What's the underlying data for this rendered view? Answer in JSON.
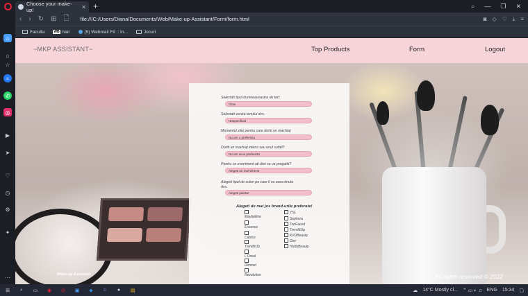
{
  "browser": {
    "tab_title": "Choose your make-up!",
    "url": "file:///C:/Users/Diana/Documents/Web/Make-up-Assistant/Form/form.html",
    "bookmarks": [
      "Faculta",
      "hair",
      "(5) Webmail FII :: In...",
      "Jocuri"
    ],
    "wb_badge": "WB"
  },
  "navbar": {
    "brand": "~MKP ASSISTANT~",
    "links": [
      "Top Products",
      "Form",
      "Logout"
    ]
  },
  "form": {
    "questions": [
      {
        "label": "Selectati tipul dumneavoastra de ten:",
        "value": "Gras"
      },
      {
        "label": "Selectati varsta tenului dvs.",
        "value": "Nespecificat"
      },
      {
        "label": "Momentul zilei pentru care doriti un machiaj:",
        "value": "Nu am o preferinta"
      },
      {
        "label": "Doriti un machiaj intens sau unul subtil?",
        "value": "Nu am nicio preferinta"
      },
      {
        "label": "Pentru ce eveniment ati dori sa va pregatiti?",
        "value": "Alegeti un eveniment!"
      },
      {
        "label": "Alegeti tipul de culori pe care il va avea tinuta dvs.",
        "value": "Alegeti paleta!"
      }
    ],
    "brands_title": "Alegeti de mai jos brand-urile preferate!",
    "brands_left": [
      "Maybelline",
      "Essence",
      "Catrice",
      "TrendItUp",
      "L'Oreal",
      "Rimmel",
      "Revolution"
    ],
    "brands_right": [
      "YSL",
      "Sephora",
      "TooFaced",
      "TrendItUp",
      "KVDBeauty",
      "Dior",
      "HudaBeauty"
    ]
  },
  "footer": {
    "left": "Make-up Assistant",
    "right": "All rights reserved © 2022"
  },
  "taskbar": {
    "weather": "14°C  Mostly cl...",
    "lang": "ENG",
    "time": "15:34"
  },
  "colors": {
    "navbar": "#f7d4d9",
    "input_bg": "#f3bfcb",
    "opera_red": "#e6213a"
  }
}
